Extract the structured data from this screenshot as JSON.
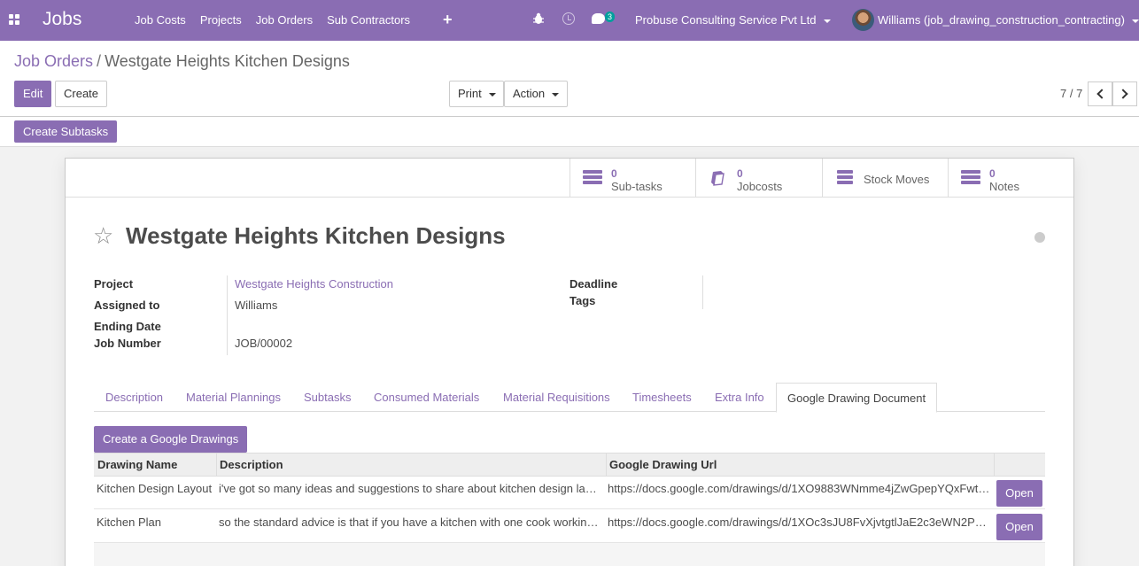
{
  "navbar": {
    "brand": "Jobs",
    "menu": [
      "Job Costs",
      "Projects",
      "Job Orders",
      "Sub Contractors"
    ],
    "plus": "+",
    "chat_count": "3",
    "company": "Probuse Consulting Service Pvt Ltd",
    "user": "Williams (job_drawing_construction_contracting)"
  },
  "breadcrumb": {
    "parent": "Job Orders",
    "separator": "/",
    "current": "Westgate Heights Kitchen Designs"
  },
  "buttons": {
    "edit": "Edit",
    "create": "Create",
    "print": "Print",
    "action": "Action",
    "create_subtasks": "Create Subtasks"
  },
  "pager": {
    "value": "7 / 7"
  },
  "smart_buttons": [
    {
      "count": "0",
      "label": "Sub-tasks"
    },
    {
      "count": "0",
      "label": "Jobcosts"
    },
    {
      "count": "",
      "label": "Stock Moves"
    },
    {
      "count": "0",
      "label": "Notes"
    }
  ],
  "record": {
    "title": "Westgate Heights Kitchen Designs",
    "labels": {
      "project": "Project",
      "assigned_to": "Assigned to",
      "ending_date": "Ending Date",
      "job_number": "Job Number",
      "deadline": "Deadline",
      "tags": "Tags"
    },
    "project": "Westgate Heights Construction",
    "assigned_to": "Williams",
    "ending_date": "",
    "job_number": "JOB/00002",
    "deadline": "",
    "tags": ""
  },
  "tabs": [
    "Description",
    "Material Plannings",
    "Subtasks",
    "Consumed Materials",
    "Material Requisitions",
    "Timesheets",
    "Extra Info",
    "Google Drawing Document"
  ],
  "active_tab": "Google Drawing Document",
  "drawings": {
    "create_button": "Create a Google Drawings",
    "columns": [
      "Drawing Name",
      "Description",
      "Google Drawing Url"
    ],
    "rows": [
      {
        "name": "Kitchen Design Layout",
        "description": "i've got so many ideas and suggestions to share about kitchen design la…",
        "url": "https://docs.google.com/drawings/d/1XO9883WNmme4jZwGpepYQxFwt…",
        "open": "Open"
      },
      {
        "name": "Kitchen Plan",
        "description": "so the standard advice is that if you have a kitchen with one cook workin…",
        "url": "https://docs.google.com/drawings/d/1XOc3sJU8FvXjvtgtlJaE2c3eWN2P…",
        "open": "Open"
      }
    ]
  },
  "colors": {
    "primary": "#8a6db3",
    "badge": "#00a09d"
  }
}
